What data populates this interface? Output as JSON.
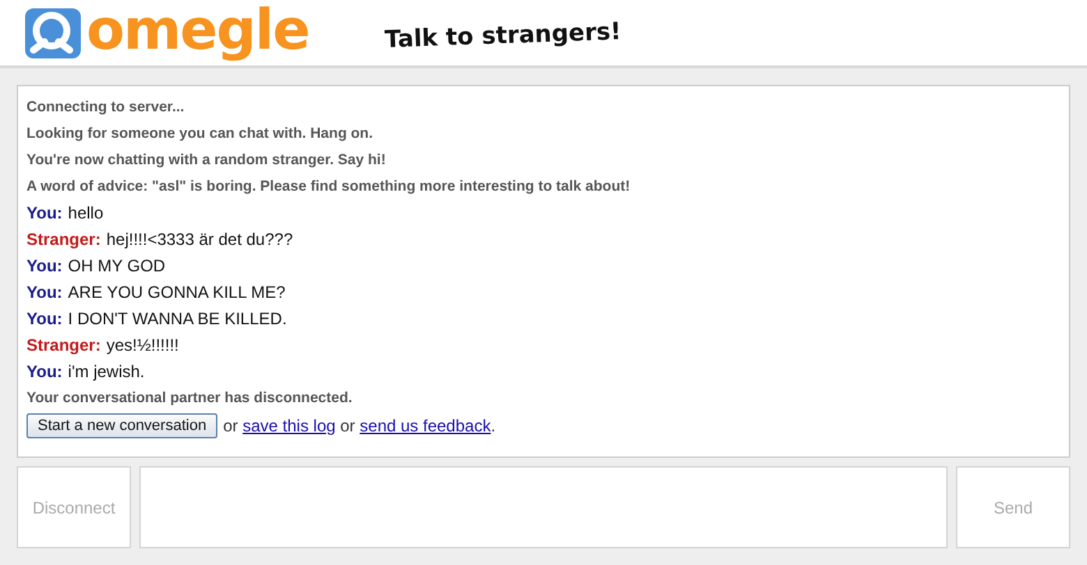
{
  "header": {
    "logo": "omegle",
    "tagline": "Talk to strangers!"
  },
  "log": [
    {
      "kind": "system",
      "text": "Connecting to server..."
    },
    {
      "kind": "system",
      "text": "Looking for someone you can chat with. Hang on."
    },
    {
      "kind": "system",
      "text": "You're now chatting with a random stranger. Say hi!"
    },
    {
      "kind": "system",
      "text": "A word of advice: \"asl\" is boring. Please find something more interesting to talk about!"
    },
    {
      "kind": "you",
      "speaker": "You:",
      "text": "hello"
    },
    {
      "kind": "stranger",
      "speaker": "Stranger:",
      "text": "hej!!!!<3333 är det du???"
    },
    {
      "kind": "you",
      "speaker": "You:",
      "text": "OH MY GOD"
    },
    {
      "kind": "you",
      "speaker": "You:",
      "text": "ARE YOU GONNA KILL ME?"
    },
    {
      "kind": "you",
      "speaker": "You:",
      "text": "I DON'T WANNA BE KILLED."
    },
    {
      "kind": "stranger",
      "speaker": "Stranger:",
      "text": "yes!½!!!!!!"
    },
    {
      "kind": "you",
      "speaker": "You:",
      "text": "i'm jewish."
    },
    {
      "kind": "system",
      "text": "Your conversational partner has disconnected."
    }
  ],
  "actions": {
    "button": "Start a new conversation",
    "parts": [
      {
        "kind": "text",
        "text": "or"
      },
      {
        "kind": "link",
        "text": "save this log"
      },
      {
        "kind": "text",
        "text": "or"
      },
      {
        "kind": "link",
        "text": "send us feedback"
      },
      {
        "kind": "text",
        "text": "."
      }
    ]
  },
  "controls": {
    "disconnect": {
      "label": "Disconnect",
      "disabled": true
    },
    "send": {
      "label": "Send",
      "disabled": true
    }
  }
}
